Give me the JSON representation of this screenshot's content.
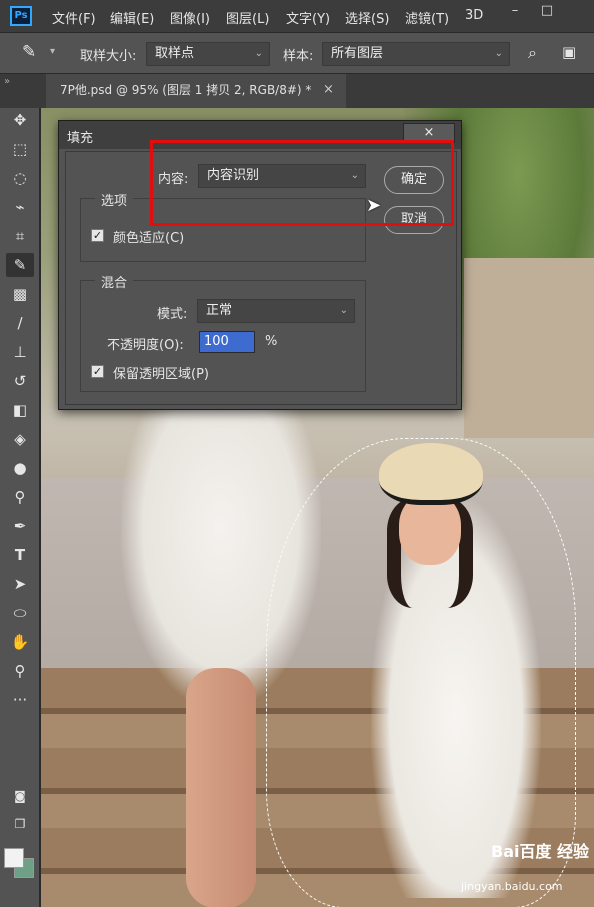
{
  "app": {
    "logo_text": "Ps",
    "menu": [
      "文件(F)",
      "编辑(E)",
      "图像(I)",
      "图层(L)",
      "文字(Y)",
      "选择(S)",
      "滤镜(T)",
      "3D"
    ],
    "window_controls": [
      "–",
      "□"
    ]
  },
  "options_bar": {
    "tool_icon": "eyedropper-icon",
    "sample_size_label": "取样大小:",
    "sample_size_value": "取样点",
    "sample_label": "样本:",
    "sample_value": "所有图层"
  },
  "document_tab": {
    "title": "7P他.psd @ 95% (图层 1 拷贝 2, RGB/8#) *",
    "close": "×"
  },
  "toolbar": {
    "tools": [
      "move-icon",
      "marquee-icon",
      "lasso-icon",
      "quick-select-icon",
      "crop-icon",
      "eyedropper-icon",
      "healing-icon",
      "brush-icon",
      "stamp-icon",
      "history-brush-icon",
      "eraser-icon",
      "bucket-icon",
      "blur-icon",
      "dodge-icon",
      "pen-icon",
      "type-icon",
      "path-select-icon",
      "shape-icon",
      "hand-icon",
      "zoom-icon",
      "more-icon"
    ],
    "foreground_color": "#f2f2f2",
    "background_color": "#6ea088"
  },
  "dialog": {
    "title": "填充",
    "close": "×",
    "content_label": "内容:",
    "content_value": "内容识别",
    "ok_button": "确定",
    "cancel_button": "取消",
    "options_group": "选项",
    "color_adapt_label": "颜色适应(C)",
    "color_adapt_checked": true,
    "blend_group": "混合",
    "mode_label": "模式:",
    "mode_value": "正常",
    "opacity_label": "不透明度(O):",
    "opacity_value": "100",
    "opacity_unit": "%",
    "preserve_label": "保留透明区域(P)",
    "preserve_checked": true
  },
  "watermark": {
    "brand": "Bai百度 经验",
    "url": "jingyan.baidu.com"
  },
  "colors": {
    "annotation": "#e30d0d",
    "selected_input": "#3d6bd0"
  }
}
